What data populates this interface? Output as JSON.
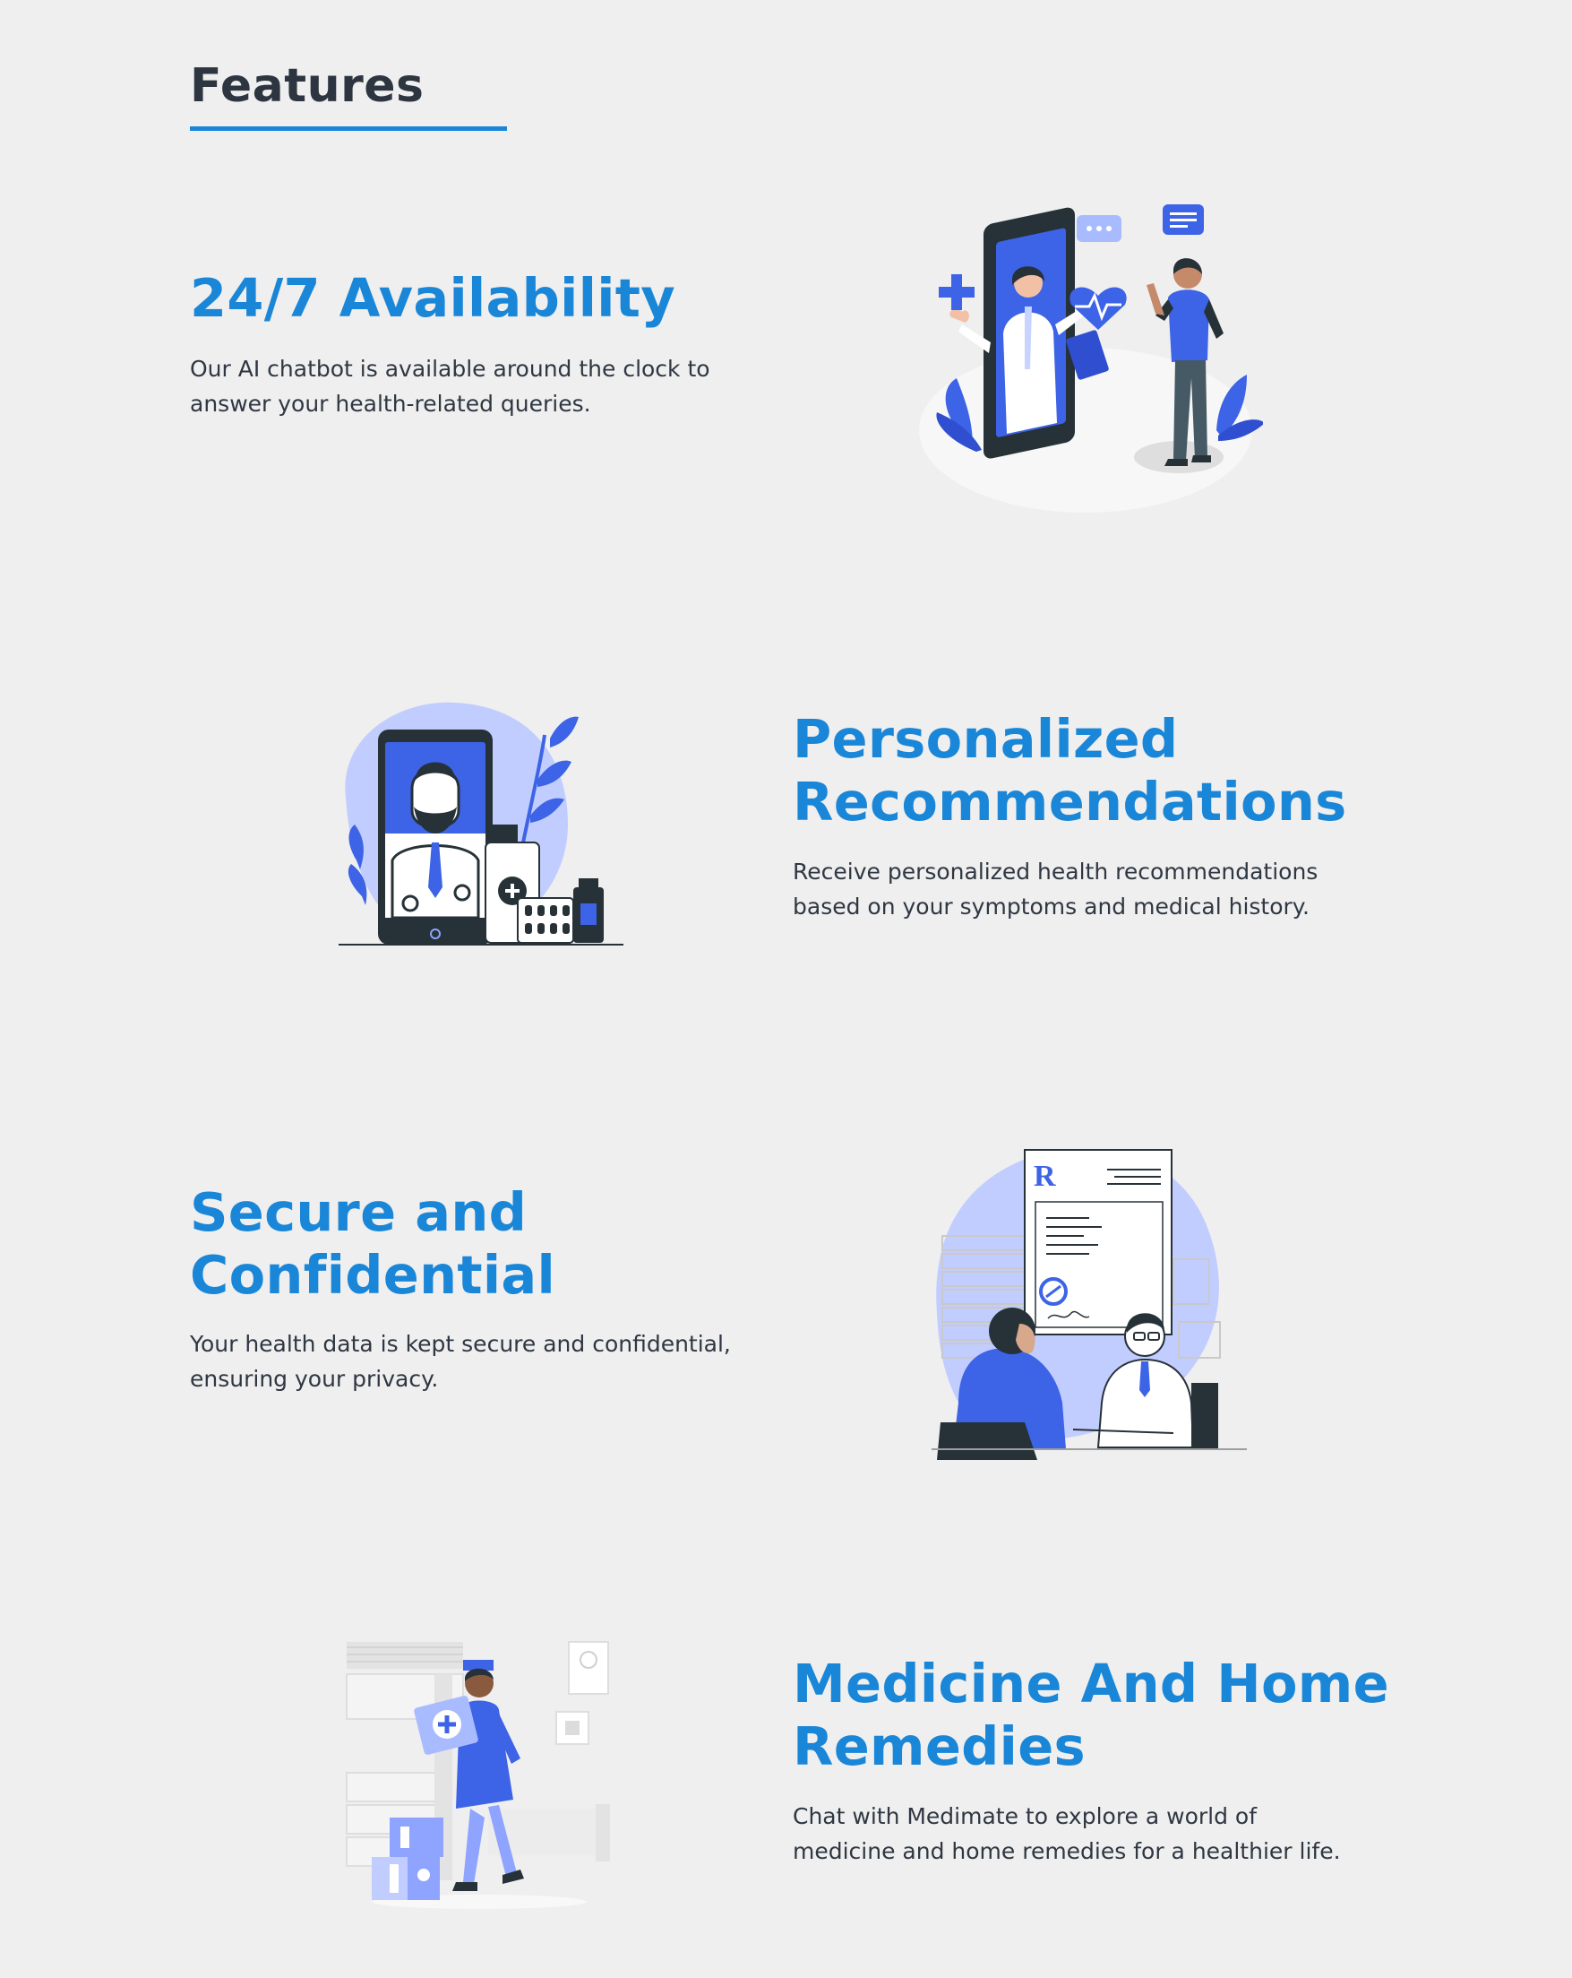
{
  "features_section": {
    "title": "Features",
    "accent_color": "#1a86d8",
    "items": [
      {
        "heading": "24/7 Availability",
        "description_line1": "Our AI chatbot is available around the clock to",
        "description_line2": "answer your health-related queries.",
        "illustration": "doctor-video-call-illustration"
      },
      {
        "heading_line1": "Personalized",
        "heading_line2": "Recommendations",
        "description_line1": "Receive personalized health recommendations",
        "description_line2": "based on your symptoms and medical history.",
        "illustration": "doctor-on-phone-illustration"
      },
      {
        "heading_line1": "Secure and",
        "heading_line2": "Confidential",
        "description_line1": "Your health data is kept secure and confidential,",
        "description_line2": "ensuring your privacy.",
        "illustration": "prescription-consultation-illustration"
      },
      {
        "heading_line1": "Medicine And Home",
        "heading_line2": "Remedies",
        "description_line1": "Chat with Medimate to explore a world of",
        "description_line2": "medicine and home remedies for a healthier life.",
        "illustration": "nurse-carrying-medicine-illustration"
      }
    ]
  }
}
